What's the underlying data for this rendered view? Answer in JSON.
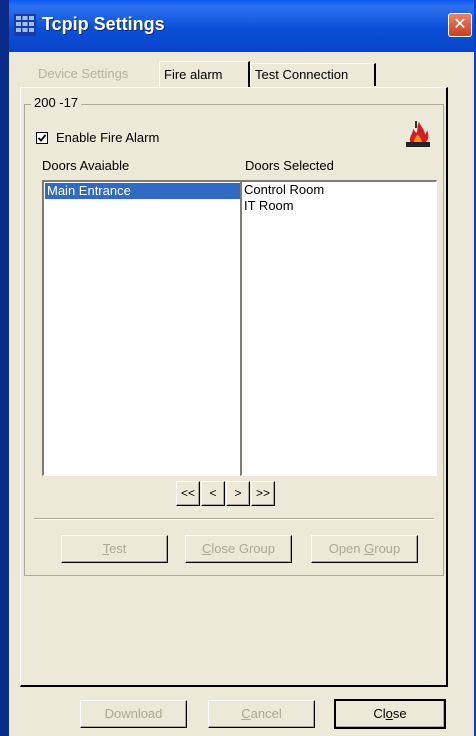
{
  "window": {
    "title": "Tcpip Settings",
    "close_glyph": "✕"
  },
  "tabs": [
    {
      "label": "Device Settings",
      "state": "disabled"
    },
    {
      "label": "Fire alarm",
      "state": "active"
    },
    {
      "label": "Test Connection",
      "state": "normal"
    }
  ],
  "group": {
    "label": "200 -17"
  },
  "enable_fire_alarm": {
    "label": "Enable Fire Alarm",
    "checked": true
  },
  "doors_available": {
    "label": "Doors Avaiable",
    "items": [
      "Main Entrance"
    ],
    "selected_item": "Main Entrance"
  },
  "doors_selected": {
    "label": "Doors Selected",
    "items": [
      "Control Room",
      "IT Room"
    ]
  },
  "arrows": {
    "move_all_left": "<<",
    "move_left": "<",
    "move_right": ">",
    "move_all_right": ">>"
  },
  "group_buttons": {
    "test": {
      "pre": "",
      "key": "T",
      "post": "est",
      "enabled": false
    },
    "close_group": {
      "pre": "",
      "key": "C",
      "post": "lose Group",
      "enabled": false
    },
    "open_group": {
      "pre": "Open ",
      "key": "G",
      "post": "roup",
      "enabled": false
    }
  },
  "footer_buttons": {
    "download": {
      "label": "Download",
      "enabled": false
    },
    "cancel": {
      "pre": "",
      "key": "C",
      "post": "ancel",
      "enabled": false
    },
    "close": {
      "pre": "Cl",
      "key": "o",
      "post": "se",
      "enabled": true
    }
  },
  "colors": {
    "titlebar": "#0b4fd8",
    "selection": "#3169c6",
    "face": "#ece9d8",
    "close_button": "#d6502e"
  },
  "icons": {
    "title": "grid-app-icon",
    "fire": "fire-alarm-icon",
    "check": "checkmark-icon"
  }
}
